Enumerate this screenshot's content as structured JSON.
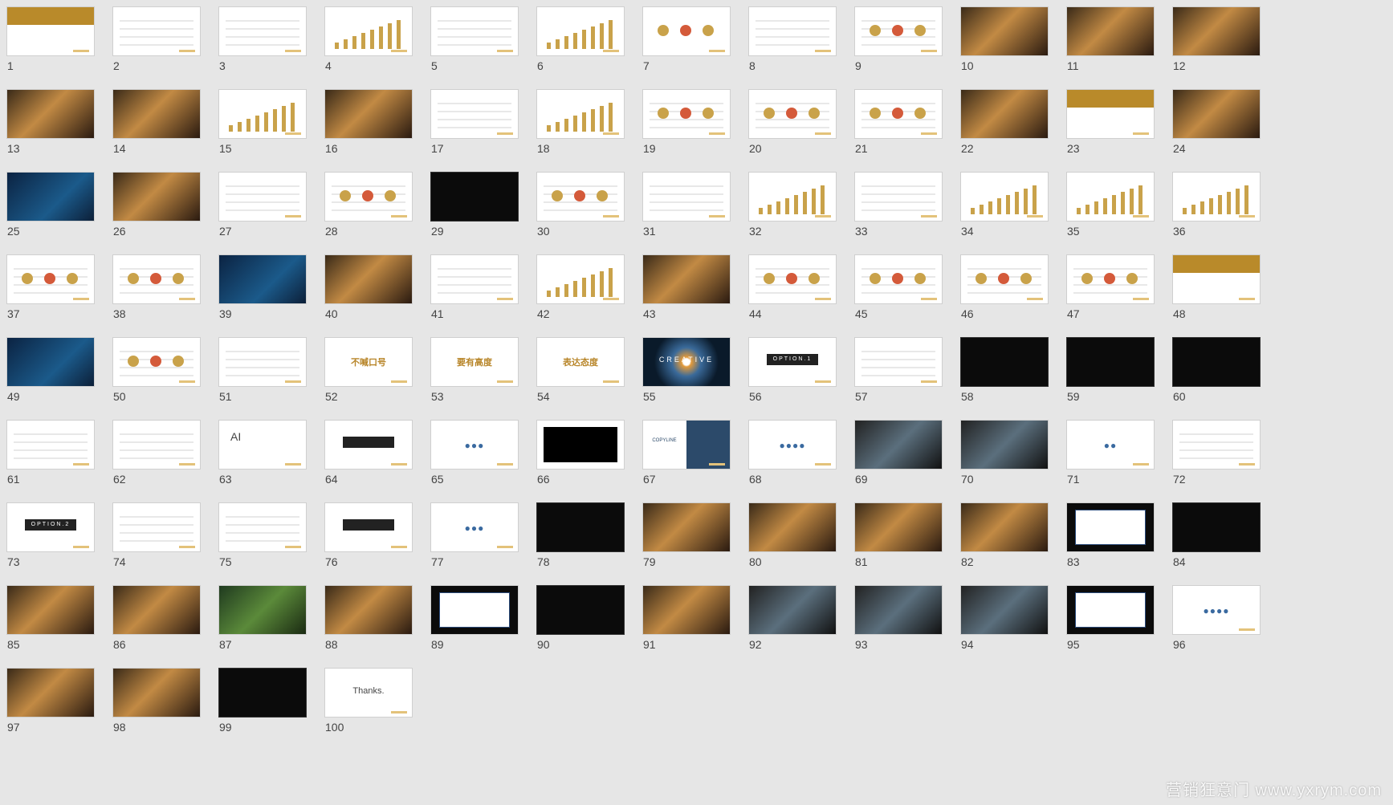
{
  "watermark": "营销狂意门 www.yxrym.com",
  "slides": [
    {
      "n": "1",
      "kind": "gold"
    },
    {
      "n": "2",
      "kind": "text"
    },
    {
      "n": "3",
      "kind": "text"
    },
    {
      "n": "4",
      "kind": "chart"
    },
    {
      "n": "5",
      "kind": "table"
    },
    {
      "n": "6",
      "kind": "chart"
    },
    {
      "n": "7",
      "kind": "circle"
    },
    {
      "n": "8",
      "kind": "text"
    },
    {
      "n": "9",
      "kind": "diagram"
    },
    {
      "n": "10",
      "kind": "photos"
    },
    {
      "n": "11",
      "kind": "photos"
    },
    {
      "n": "12",
      "kind": "photos"
    },
    {
      "n": "13",
      "kind": "photos"
    },
    {
      "n": "14",
      "kind": "photos"
    },
    {
      "n": "15",
      "kind": "chart"
    },
    {
      "n": "16",
      "kind": "photo"
    },
    {
      "n": "17",
      "kind": "text"
    },
    {
      "n": "18",
      "kind": "chart"
    },
    {
      "n": "19",
      "kind": "diagram"
    },
    {
      "n": "20",
      "kind": "diagram"
    },
    {
      "n": "21",
      "kind": "diagram"
    },
    {
      "n": "22",
      "kind": "photos"
    },
    {
      "n": "23",
      "kind": "gold"
    },
    {
      "n": "24",
      "kind": "photo"
    },
    {
      "n": "25",
      "kind": "navy"
    },
    {
      "n": "26",
      "kind": "photo"
    },
    {
      "n": "27",
      "kind": "text"
    },
    {
      "n": "28",
      "kind": "diagram"
    },
    {
      "n": "29",
      "kind": "dark"
    },
    {
      "n": "30",
      "kind": "diagram"
    },
    {
      "n": "31",
      "kind": "table"
    },
    {
      "n": "32",
      "kind": "chart"
    },
    {
      "n": "33",
      "kind": "table"
    },
    {
      "n": "34",
      "kind": "chart"
    },
    {
      "n": "35",
      "kind": "chart"
    },
    {
      "n": "36",
      "kind": "chart"
    },
    {
      "n": "37",
      "kind": "diagram"
    },
    {
      "n": "38",
      "kind": "diagram"
    },
    {
      "n": "39",
      "kind": "navy"
    },
    {
      "n": "40",
      "kind": "photos"
    },
    {
      "n": "41",
      "kind": "text"
    },
    {
      "n": "42",
      "kind": "chart"
    },
    {
      "n": "43",
      "kind": "photos"
    },
    {
      "n": "44",
      "kind": "diagram"
    },
    {
      "n": "45",
      "kind": "diagram"
    },
    {
      "n": "46",
      "kind": "diagram"
    },
    {
      "n": "47",
      "kind": "diagram"
    },
    {
      "n": "48",
      "kind": "gold"
    },
    {
      "n": "49",
      "kind": "navy"
    },
    {
      "n": "50",
      "kind": "diagram"
    },
    {
      "n": "51",
      "kind": "table"
    },
    {
      "n": "52",
      "kind": "quote",
      "text": "不喊口号"
    },
    {
      "n": "53",
      "kind": "quote",
      "text": "要有高度"
    },
    {
      "n": "54",
      "kind": "quote",
      "text": "表达态度"
    },
    {
      "n": "55",
      "kind": "eye",
      "text": "CREATIVE"
    },
    {
      "n": "56",
      "kind": "option",
      "text": "OPTION.1"
    },
    {
      "n": "57",
      "kind": "text"
    },
    {
      "n": "58",
      "kind": "dark"
    },
    {
      "n": "59",
      "kind": "dark"
    },
    {
      "n": "60",
      "kind": "dark"
    },
    {
      "n": "61",
      "kind": "text"
    },
    {
      "n": "62",
      "kind": "text"
    },
    {
      "n": "63",
      "kind": "ai",
      "text": "AI"
    },
    {
      "n": "64",
      "kind": "option"
    },
    {
      "n": "65",
      "kind": "dots",
      "text": "●●●"
    },
    {
      "n": "66",
      "kind": "blackrect"
    },
    {
      "n": "67",
      "kind": "copy",
      "text": "COPYLINE"
    },
    {
      "n": "68",
      "kind": "dots",
      "text": "●●●●"
    },
    {
      "n": "69",
      "kind": "photo2"
    },
    {
      "n": "70",
      "kind": "photo2"
    },
    {
      "n": "71",
      "kind": "dots",
      "text": "●●"
    },
    {
      "n": "72",
      "kind": "text"
    },
    {
      "n": "73",
      "kind": "option",
      "text": "OPTION.2"
    },
    {
      "n": "74",
      "kind": "text"
    },
    {
      "n": "75",
      "kind": "text"
    },
    {
      "n": "76",
      "kind": "option"
    },
    {
      "n": "77",
      "kind": "dots",
      "text": "●●●"
    },
    {
      "n": "78",
      "kind": "dark"
    },
    {
      "n": "79",
      "kind": "photo"
    },
    {
      "n": "80",
      "kind": "photo"
    },
    {
      "n": "81",
      "kind": "photo"
    },
    {
      "n": "82",
      "kind": "photo"
    },
    {
      "n": "83",
      "kind": "blue"
    },
    {
      "n": "84",
      "kind": "dark"
    },
    {
      "n": "85",
      "kind": "photo"
    },
    {
      "n": "86",
      "kind": "photo"
    },
    {
      "n": "87",
      "kind": "green"
    },
    {
      "n": "88",
      "kind": "photo"
    },
    {
      "n": "89",
      "kind": "blue"
    },
    {
      "n": "90",
      "kind": "dark"
    },
    {
      "n": "91",
      "kind": "photo"
    },
    {
      "n": "92",
      "kind": "photo2"
    },
    {
      "n": "93",
      "kind": "photo2"
    },
    {
      "n": "94",
      "kind": "photo2"
    },
    {
      "n": "95",
      "kind": "blue"
    },
    {
      "n": "96",
      "kind": "dots",
      "text": "●●●●"
    },
    {
      "n": "97",
      "kind": "photos"
    },
    {
      "n": "98",
      "kind": "photo"
    },
    {
      "n": "99",
      "kind": "dark"
    },
    {
      "n": "100",
      "kind": "thanks",
      "text": "Thanks."
    }
  ]
}
